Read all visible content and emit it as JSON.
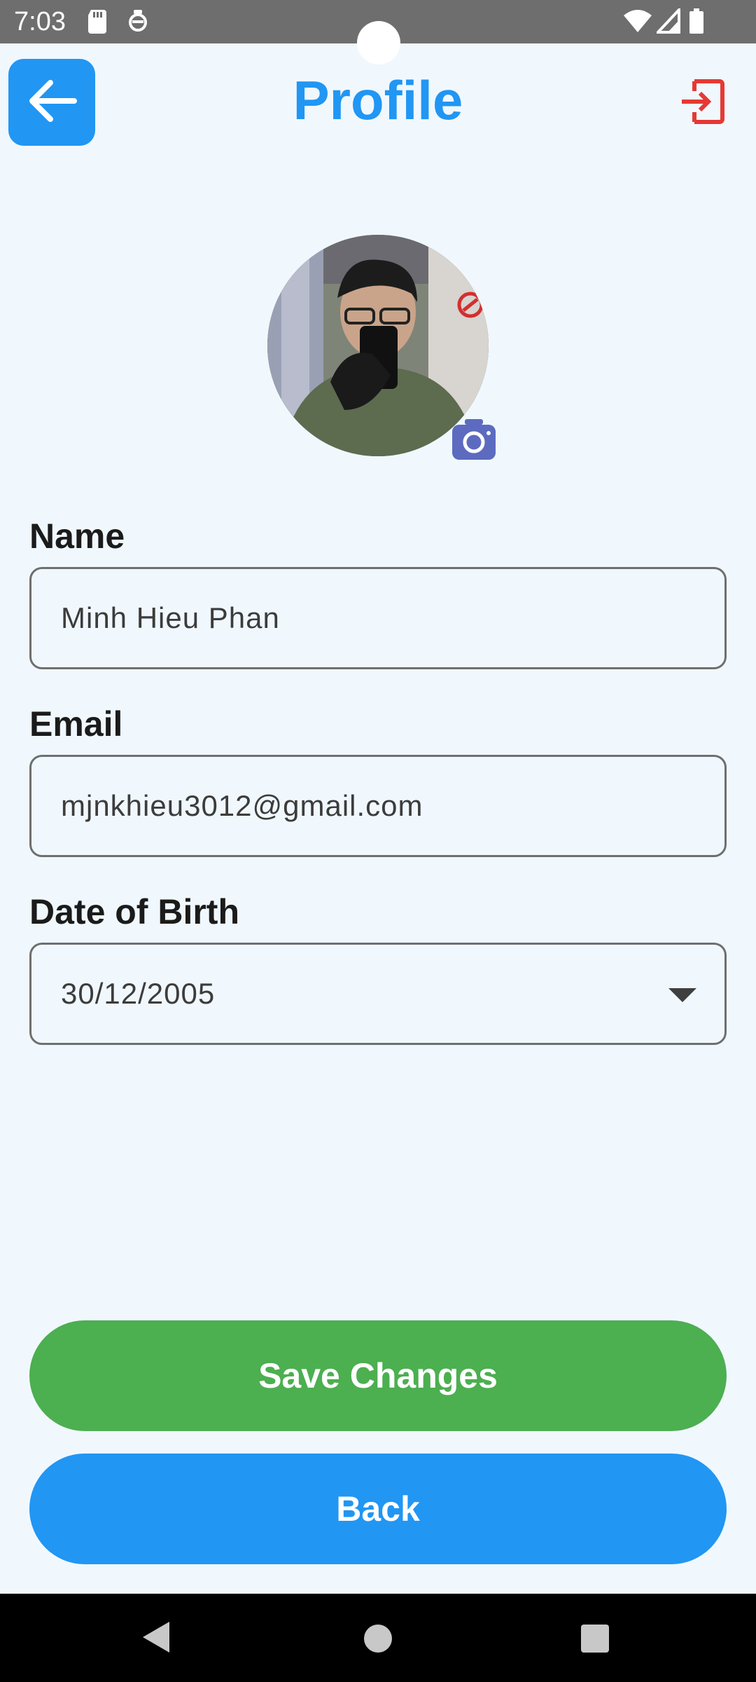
{
  "status_bar": {
    "time": "7:03",
    "icons": [
      "sd-card-icon",
      "notification-icon",
      "wifi-icon",
      "signal-icon",
      "battery-icon"
    ]
  },
  "header": {
    "title": "Profile",
    "back_icon": "arrow-left-icon",
    "logout_icon": "logout-icon"
  },
  "avatar": {
    "camera_icon": "camera-icon"
  },
  "form": {
    "name": {
      "label": "Name",
      "value": "Minh Hieu Phan"
    },
    "email": {
      "label": "Email",
      "value": "mjnkhieu3012@gmail.com"
    },
    "dob": {
      "label": "Date of Birth",
      "value": "30/12/2005"
    }
  },
  "actions": {
    "save_label": "Save Changes",
    "back_label": "Back"
  },
  "colors": {
    "primary": "#2196F3",
    "success": "#4CAF50",
    "danger": "#E53935",
    "background": "#F0F8FE",
    "camera_badge": "#5C6BC0"
  }
}
